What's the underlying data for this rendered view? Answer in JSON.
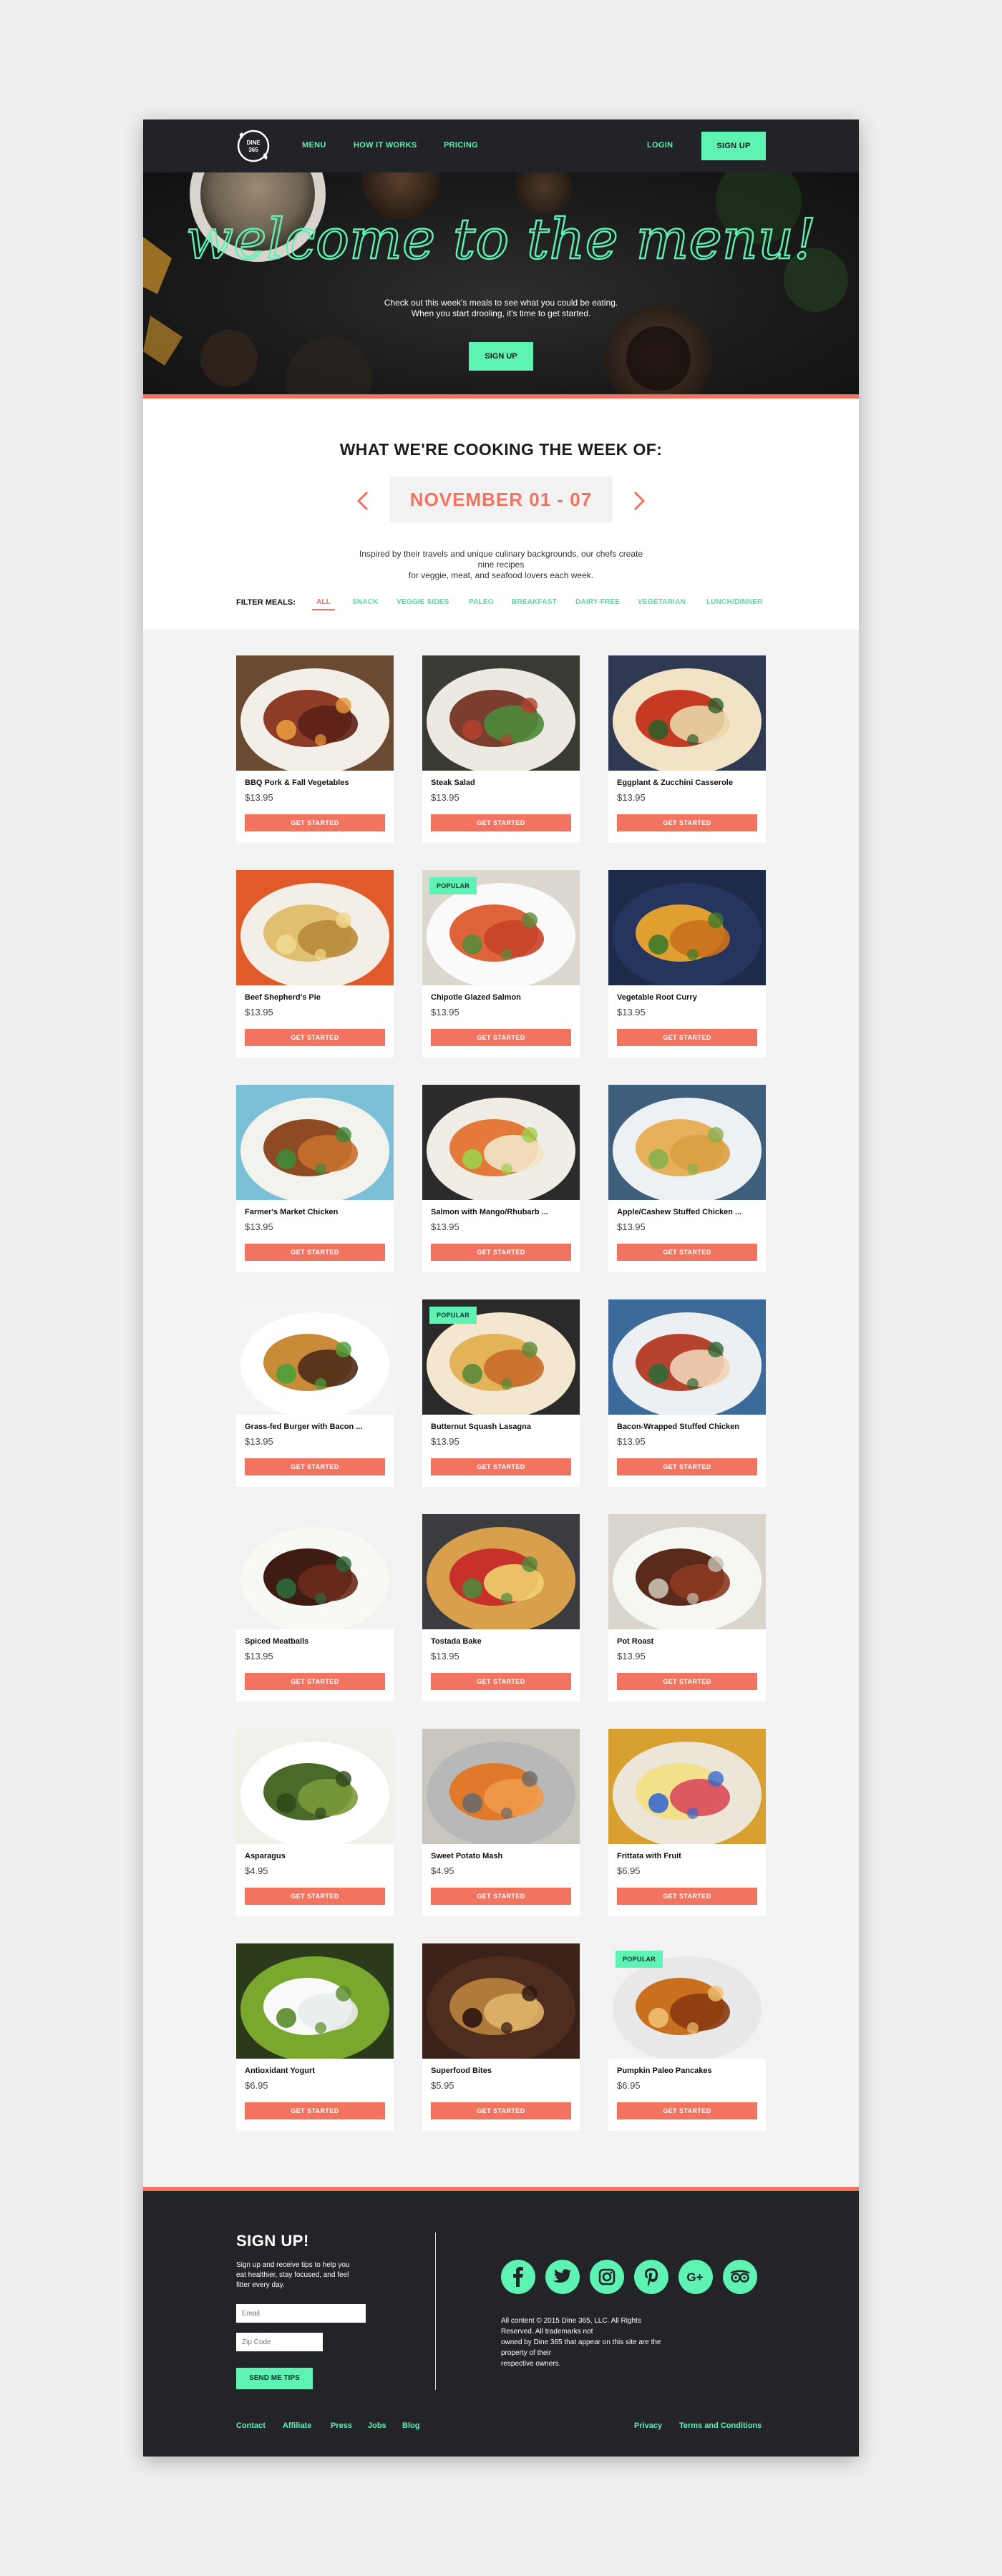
{
  "nav": {
    "logo_text": "DINE 365",
    "menu": "MENU",
    "how_it_works": "HOW IT WORKS",
    "pricing": "PRICING",
    "login": "LOGIN",
    "signup": "SIGN UP"
  },
  "hero": {
    "title": "welcome to the menu!",
    "subtitle_line1": "Check out this week's meals to see what you could be eating.",
    "subtitle_line2": "When you start drooling, it's time to get started.",
    "button": "SIGN UP"
  },
  "week": {
    "heading": "WHAT WE'RE COOKING THE WEEK OF:",
    "range": "NOVEMBER 01 - 07",
    "prev_icon": "chevron-left-icon",
    "next_icon": "chevron-right-icon",
    "desc_line1": "Inspired by their travels and unique culinary backgrounds, our chefs create nine recipes",
    "desc_line2": "for veggie, meat, and seafood lovers each week."
  },
  "filters": {
    "label": "FILTER MEALS:",
    "items": [
      "ALL",
      "SNACK",
      "VEGGIE SIDES",
      "PALEO",
      "BREAKFAST",
      "DAIRY-FREE",
      "VEGETARIAN",
      "LUNCH/DINNER"
    ],
    "active": "ALL"
  },
  "meals": [
    {
      "name": "BBQ Pork & Fall Vegetables",
      "price": "$13.95",
      "button": "GET STARTED",
      "badge": ""
    },
    {
      "name": "Steak Salad",
      "price": "$13.95",
      "button": "GET STARTED",
      "badge": ""
    },
    {
      "name": "Eggplant & Zucchini Casserole",
      "price": "$13.95",
      "button": "GET STARTED",
      "badge": ""
    },
    {
      "name": "Beef Shepherd's Pie",
      "price": "$13.95",
      "button": "GET STARTED",
      "badge": ""
    },
    {
      "name": "Chipotle Glazed Salmon",
      "price": "$13.95",
      "button": "GET STARTED",
      "badge": "POPULAR"
    },
    {
      "name": "Vegetable Root Curry",
      "price": "$13.95",
      "button": "GET STARTED",
      "badge": ""
    },
    {
      "name": "Farmer's Market Chicken",
      "price": "$13.95",
      "button": "GET STARTED",
      "badge": ""
    },
    {
      "name": "Salmon with Mango/Rhubarb ...",
      "price": "$13.95",
      "button": "GET STARTED",
      "badge": ""
    },
    {
      "name": "Apple/Cashew Stuffed Chicken ...",
      "price": "$13.95",
      "button": "GET STARTED",
      "badge": ""
    },
    {
      "name": "Grass-fed Burger with Bacon ...",
      "price": "$13.95",
      "button": "GET STARTED",
      "badge": ""
    },
    {
      "name": "Butternut Squash Lasagna",
      "price": "$13.95",
      "button": "GET STARTED",
      "badge": "POPULAR"
    },
    {
      "name": "Bacon-Wrapped Stuffed Chicken",
      "price": "$13.95",
      "button": "GET STARTED",
      "badge": ""
    },
    {
      "name": "Spiced Meatballs",
      "price": "$13.95",
      "button": "GET STARTED",
      "badge": ""
    },
    {
      "name": "Tostada Bake",
      "price": "$13.95",
      "button": "GET STARTED",
      "badge": ""
    },
    {
      "name": "Pot Roast",
      "price": "$13.95",
      "button": "GET STARTED",
      "badge": ""
    },
    {
      "name": "Asparagus",
      "price": "$4.95",
      "button": "GET STARTED",
      "badge": ""
    },
    {
      "name": "Sweet Potato Mash",
      "price": "$4.95",
      "button": "GET STARTED",
      "badge": ""
    },
    {
      "name": "Frittata with Fruit",
      "price": "$6.95",
      "button": "GET STARTED",
      "badge": ""
    },
    {
      "name": "Antioxidant Yogurt",
      "price": "$6.95",
      "button": "GET STARTED",
      "badge": ""
    },
    {
      "name": "Superfood Bites",
      "price": "$5.95",
      "button": "GET STARTED",
      "badge": ""
    },
    {
      "name": "Pumpkin Paleo Pancakes",
      "price": "$6.95",
      "button": "GET STARTED",
      "badge": "POPULAR"
    }
  ],
  "footer": {
    "signup_title": "SIGN UP!",
    "signup_desc_line1": "Sign up and receive tips to help you",
    "signup_desc_line2": "eat healthier, stay focused, and feel",
    "signup_desc_line3": "fitter every day.",
    "email_placeholder": "Email",
    "zip_placeholder": "Zip Code",
    "send_button": "SEND ME TIPS",
    "social_icons": [
      "facebook-icon",
      "twitter-icon",
      "instagram-icon",
      "pinterest-icon",
      "google-plus-icon",
      "tripadvisor-icon"
    ],
    "legal_line1": "All content © 2015 Dine 365, LLC. All Rights Reserved. All trademarks not",
    "legal_line2": "owned by Dine 365 that appear on this site are the property of their",
    "legal_line3": "respective owners.",
    "links": [
      "Contact",
      "Affiliate",
      "Press",
      "Jobs",
      "Blog"
    ],
    "privacy": "Privacy",
    "terms": "Terms and Conditions"
  },
  "colors": {
    "accent_coral": "#f27360",
    "accent_mint": "#5ef2b3",
    "dark": "#222326"
  }
}
